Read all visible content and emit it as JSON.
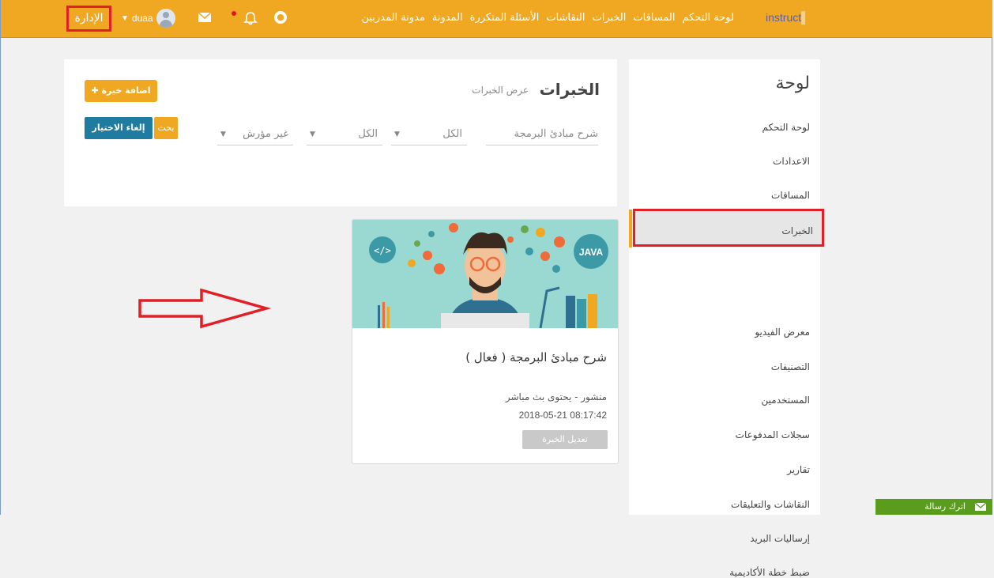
{
  "topbar": {
    "logo": "instruct",
    "nav": [
      "لوحة التحكم",
      "المساقات",
      "الخبرات",
      "النقاشات",
      "الأسئلة المتكررة",
      "المدونة",
      "مدونة المدربين"
    ],
    "user_name": "duaa",
    "admin_label": "الإدارة"
  },
  "sidebar": {
    "title": "لوحة",
    "items": [
      "لوحة التحكم",
      "الاعدادات",
      "المساقات",
      "الخبرات",
      "معرض الفيديو",
      "التصنيفات",
      "المستخدمين",
      "سجلات المدفوعات",
      "تقارير",
      "النقاشات والتعليقات",
      "إرساليات البريد",
      "ضبط خطة الأكاديمية"
    ],
    "active_index": 3
  },
  "panel": {
    "title": "الخبرات",
    "subtitle": "عرض الخبرات",
    "add_button": "اضافة خبرة",
    "search_placeholder": "شرح مبادئ البرمجة",
    "filter1": "الكل",
    "filter2": "الكل",
    "filter3": "غير مؤرش",
    "search_button": "بحث",
    "clear_button": "إلغاء الاختيار"
  },
  "card": {
    "badge": "JAVA",
    "title": "شرح مبادئ البرمجة ( فعال )",
    "status": "منشور - يحتوى بث مباشر",
    "date": "2018-05-21 08:17:42",
    "edit_button": "تعديل الخبرة"
  },
  "message_button": "اترك رسالة",
  "colors": {
    "accent": "#f0a823",
    "highlight": "#e01f26",
    "primary": "#1f7ba0",
    "green": "#5a9c1c"
  }
}
